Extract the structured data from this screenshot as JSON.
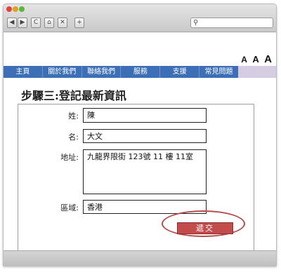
{
  "browser": {
    "controls": {
      "back": "◀",
      "forward": "▶",
      "reload": "C",
      "home": "⌂",
      "stop": "✕",
      "new_tab": "+"
    },
    "url_icon": "search-icon"
  },
  "font_sizes": [
    "A",
    "A",
    "A"
  ],
  "nav": {
    "items": [
      "主頁",
      "關於我們",
      "聯絡我們",
      "服務",
      "支援",
      "常見問題"
    ]
  },
  "page": {
    "title": "步驟三:登記最新資訊"
  },
  "form": {
    "surname_label": "姓:",
    "surname_value": "陳",
    "given_label": "名:",
    "given_value": "大文",
    "address_label": "地址:",
    "address_value": "九龍界限街 123號 11 樓 11室",
    "region_label": "區域:",
    "region_value": "香港",
    "submit_label": "遞交"
  },
  "colors": {
    "nav_bg": "#3c6fb6",
    "submit_bg": "#c24b4b",
    "highlight_ring": "#b54b4b"
  }
}
